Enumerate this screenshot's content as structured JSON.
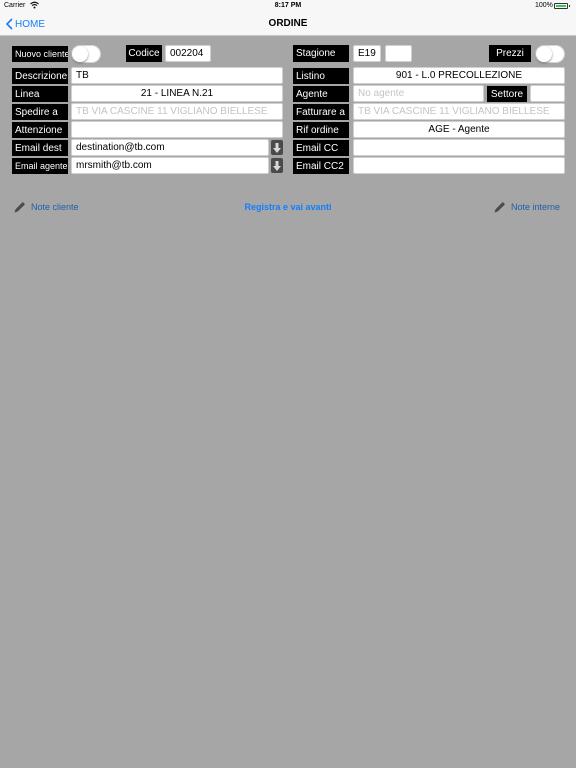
{
  "status": {
    "carrier": "Carrier",
    "time": "8:17 PM",
    "battery": "100%"
  },
  "nav": {
    "back_label": "HOME",
    "title": "ORDINE"
  },
  "form": {
    "nuovo_cliente": {
      "label": "Nuovo cliente",
      "on": false
    },
    "codice": {
      "label": "Codice",
      "value": "002204"
    },
    "stagione": {
      "label": "Stagione",
      "value": "E19",
      "value2": ""
    },
    "prezzi": {
      "label": "Prezzi",
      "on": false
    },
    "descrizione": {
      "label": "Descrizione",
      "value": "TB"
    },
    "listino": {
      "label": "Listino",
      "value": "901 - L.0 PRECOLLEZIONE"
    },
    "linea": {
      "label": "Linea",
      "value": "21 - LINEA N.21"
    },
    "agente": {
      "label": "Agente",
      "placeholder": "No agente"
    },
    "settore": {
      "label": "Settore",
      "value": ""
    },
    "spedire_a": {
      "label": "Spedire a",
      "placeholder": "TB VIA CASCINE 11 VIGLIANO BIELLESE"
    },
    "fatturare_a": {
      "label": "Fatturare a",
      "placeholder": "TB VIA CASCINE 11 VIGLIANO BIELLESE"
    },
    "attenzione": {
      "label": "Attenzione",
      "value": ""
    },
    "rif_ordine": {
      "label": "Rif ordine",
      "value": "AGE - Agente"
    },
    "email_dest": {
      "label": "Email dest",
      "value": "destination@tb.com"
    },
    "email_cc": {
      "label": "Email CC",
      "value": ""
    },
    "email_agente": {
      "label": "Email agente",
      "value": "mrsmith@tb.com"
    },
    "email_cc2": {
      "label": "Email CC2",
      "value": ""
    }
  },
  "actions": {
    "note_cliente": "Note cliente",
    "registra": "Registra e vai avanti",
    "note_interne": "Note interne"
  }
}
